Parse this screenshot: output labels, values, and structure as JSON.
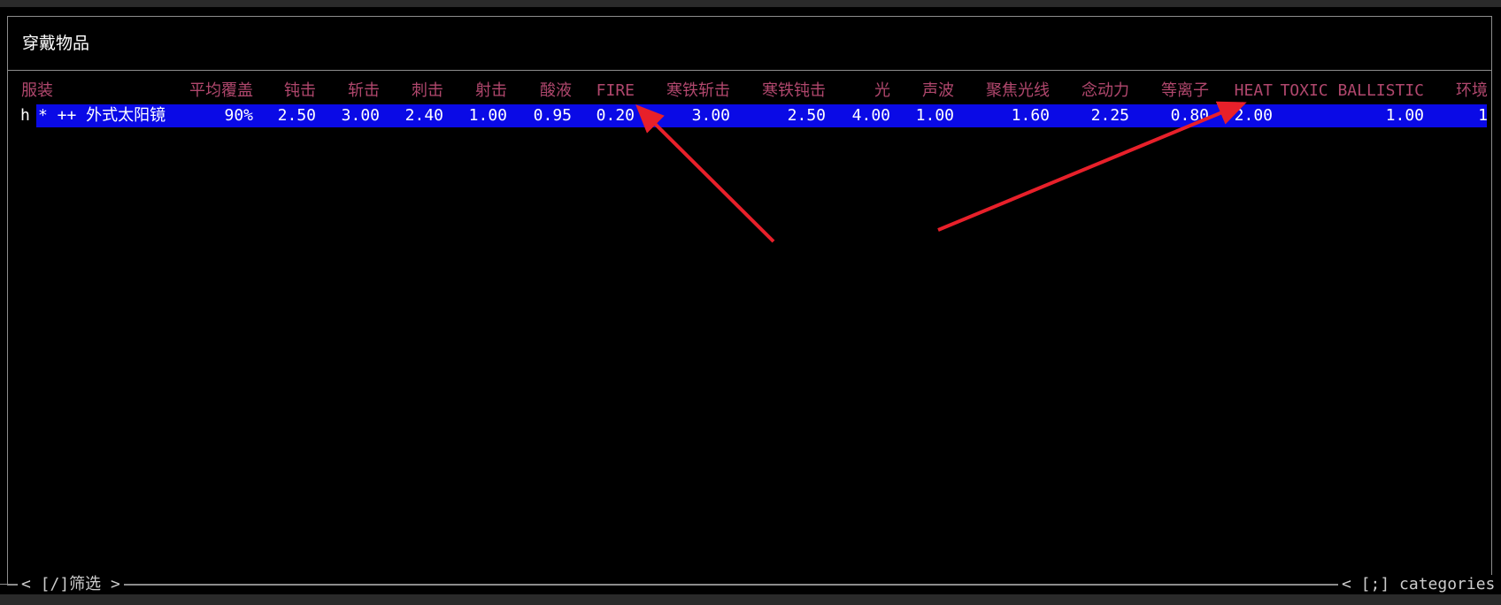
{
  "window": {
    "title": "穿戴物品"
  },
  "table": {
    "headers": [
      "服装",
      "平均覆盖",
      "钝击",
      "斩击",
      "刺击",
      "射击",
      "酸液",
      "FIRE",
      "寒铁斩击",
      "寒铁钝击",
      "光",
      "声波",
      "聚焦光线",
      "念动力",
      "等离子",
      "HEAT",
      "TOXIC BALLISTIC",
      "环境"
    ],
    "rows": [
      {
        "hotkey": "h",
        "cells": [
          "* ++ 外式太阳镜",
          "90%",
          "2.50",
          "3.00",
          "2.40",
          "1.00",
          "0.95",
          "0.20",
          "3.00",
          "2.50",
          "4.00",
          "1.00",
          "1.60",
          "2.25",
          "0.80",
          "2.00",
          "1.00",
          "1"
        ]
      }
    ]
  },
  "footer": {
    "left": "< [/]筛选 >",
    "right": "< [;] categories >"
  },
  "colors": {
    "header_text": "#b0476d",
    "selection_bg": "#0a0ae6",
    "annotation_arrow": "#e8202a",
    "border": "#8c8c8c"
  }
}
